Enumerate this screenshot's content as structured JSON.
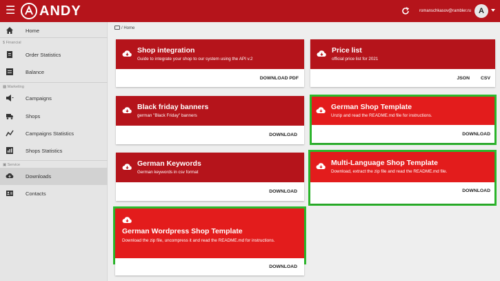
{
  "header": {
    "logo_text": "ANDY",
    "user_email": "romanschkasov@rambler.ru",
    "avatar_letter": "A",
    "icons": [
      "menu-icon",
      "logo-icon",
      "refresh-icon",
      "caret-down-icon"
    ]
  },
  "sidebar": {
    "home": "Home",
    "financial_section": "Financial",
    "order_statistics": "Order Statistics",
    "balance": "Balance",
    "marketing_section": "Marketing",
    "campaigns": "Campaigns",
    "shops": "Shops",
    "campaigns_statistics": "Campaigns Statistics",
    "shops_statistics": "Shops Statistics",
    "service_section": "Service",
    "downloads": "Downloads",
    "contacts": "Contacts"
  },
  "breadcrumb": {
    "text": "/ Home"
  },
  "cards": {
    "shop_integration": {
      "title": "Shop integration",
      "desc": "Guide to integrate your shop to our system using the API v.2",
      "action": "DOWNLOAD PDF"
    },
    "price_list": {
      "title": "Price list",
      "desc": "official price list for 2021",
      "action_json": "JSON",
      "action_csv": "CSV"
    },
    "black_friday": {
      "title": "Black friday banners",
      "desc": "german \"Black Friday\" banners",
      "action": "DOWNLOAD"
    },
    "german_shop": {
      "title": "German Shop Template",
      "desc": "Unzip and read the README.md file for instructions.",
      "action": "DOWNLOAD"
    },
    "german_keywords": {
      "title": "German Keywords",
      "desc": "German keywords in csv format",
      "action": "DOWNLOAD"
    },
    "multi_language": {
      "title": "Multi-Language Shop Template",
      "desc": "Download, extract the zip file and read the README.md file.",
      "action": "DOWNLOAD"
    },
    "german_wordpress": {
      "title": "German Wordpress Shop Template",
      "desc": "Download the zip file, uncompress it and read the README.md for instructions.",
      "action": "DOWNLOAD"
    }
  },
  "colors": {
    "brand_red": "#b5141b",
    "bright_red": "#e31c1c",
    "highlight_green": "#2dbb2d"
  }
}
